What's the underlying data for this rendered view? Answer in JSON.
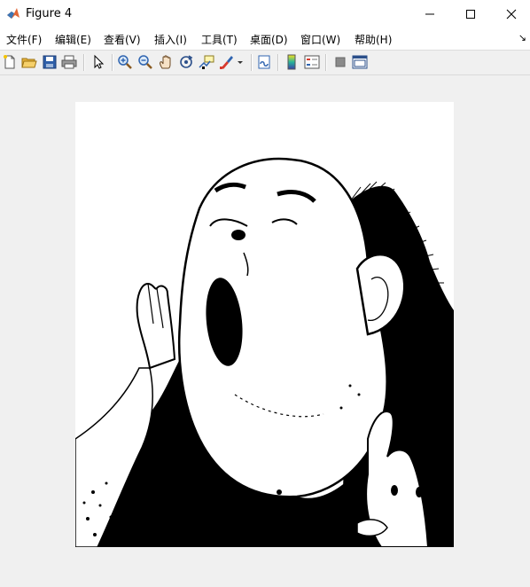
{
  "window": {
    "title": "Figure 4",
    "app_icon": "matlab-icon",
    "controls": [
      "minimize-icon",
      "maximize-icon",
      "close-icon"
    ]
  },
  "menu": {
    "items": [
      {
        "label": "文件(F)"
      },
      {
        "label": "编辑(E)"
      },
      {
        "label": "查看(V)"
      },
      {
        "label": "插入(I)"
      },
      {
        "label": "工具(T)"
      },
      {
        "label": "桌面(D)"
      },
      {
        "label": "窗口(W)"
      },
      {
        "label": "帮助(H)"
      }
    ],
    "overflow_icon": "chevron-right-icon"
  },
  "toolbar": {
    "buttons": [
      "new-figure-icon",
      "open-file-icon",
      "save-icon",
      "print-icon",
      "select-arrow-icon",
      "zoom-in-icon",
      "zoom-out-icon",
      "pan-hand-icon",
      "rotate-3d-icon",
      "data-cursor-icon",
      "brush-icon",
      "link-plot-icon",
      "colorbar-icon",
      "legend-icon",
      "hide-plot-tools-icon",
      "show-plot-tools-icon"
    ]
  },
  "figure": {
    "content": "binary-image",
    "colors": {
      "foreground": "#000000",
      "background": "#ffffff"
    }
  }
}
